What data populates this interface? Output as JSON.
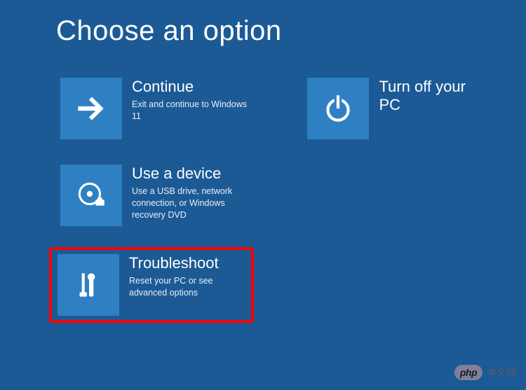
{
  "page": {
    "title": "Choose an option"
  },
  "options": {
    "continue": {
      "title": "Continue",
      "desc": "Exit and continue to Windows 11"
    },
    "use_device": {
      "title": "Use a device",
      "desc": "Use a USB drive, network connection, or Windows recovery DVD"
    },
    "troubleshoot": {
      "title": "Troubleshoot",
      "desc": "Reset your PC or see advanced options"
    },
    "turn_off": {
      "title": "Turn off your PC"
    }
  },
  "watermark": {
    "logo_text": "php",
    "label": "中文网"
  }
}
